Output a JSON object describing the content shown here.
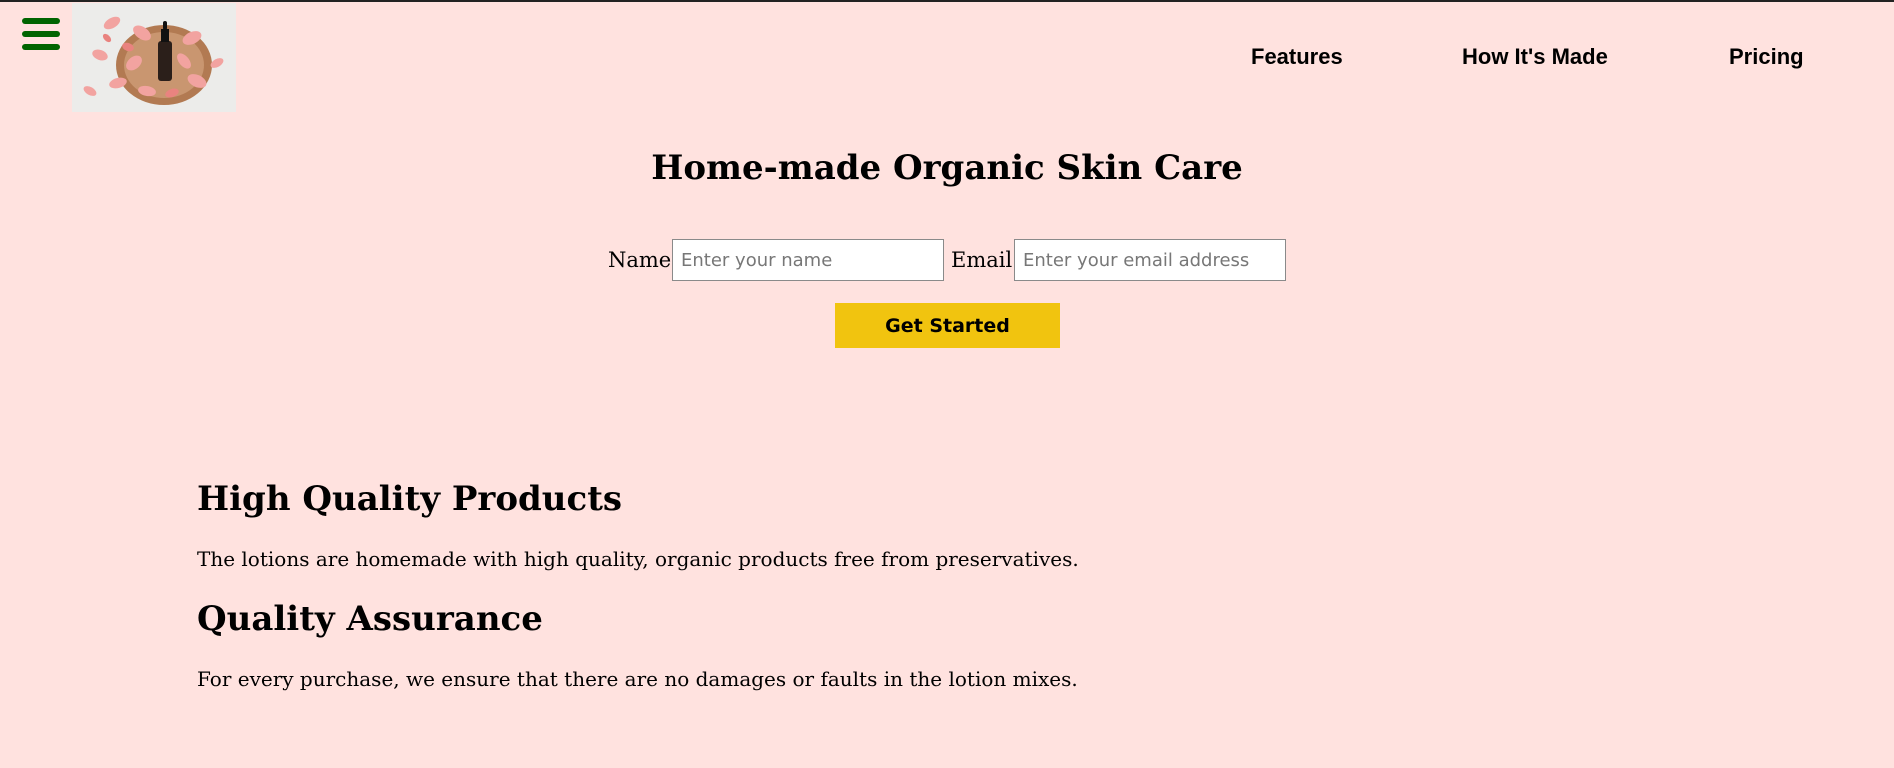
{
  "header": {
    "menu_icon": "hamburger-menu-icon",
    "logo_image": "rose-petals-serum-bottle",
    "nav": [
      {
        "label": "Features"
      },
      {
        "label": "How It's Made"
      },
      {
        "label": "Pricing"
      }
    ]
  },
  "hero": {
    "title": "Home-made Organic Skin Care",
    "name_label": "Name",
    "name_placeholder": "Enter your name",
    "email_label": "Email",
    "email_placeholder": "Enter your email address",
    "cta_label": "Get Started"
  },
  "features": [
    {
      "title": "High Quality Products",
      "text": "The lotions are homemade with high quality, organic products free from preservatives."
    },
    {
      "title": "Quality Assurance",
      "text": "For every purchase, we ensure that there are no damages or faults in the lotion mixes."
    }
  ],
  "colors": {
    "background": "#ffe2df",
    "menu_icon": "#006400",
    "cta": "#f1c40f"
  }
}
